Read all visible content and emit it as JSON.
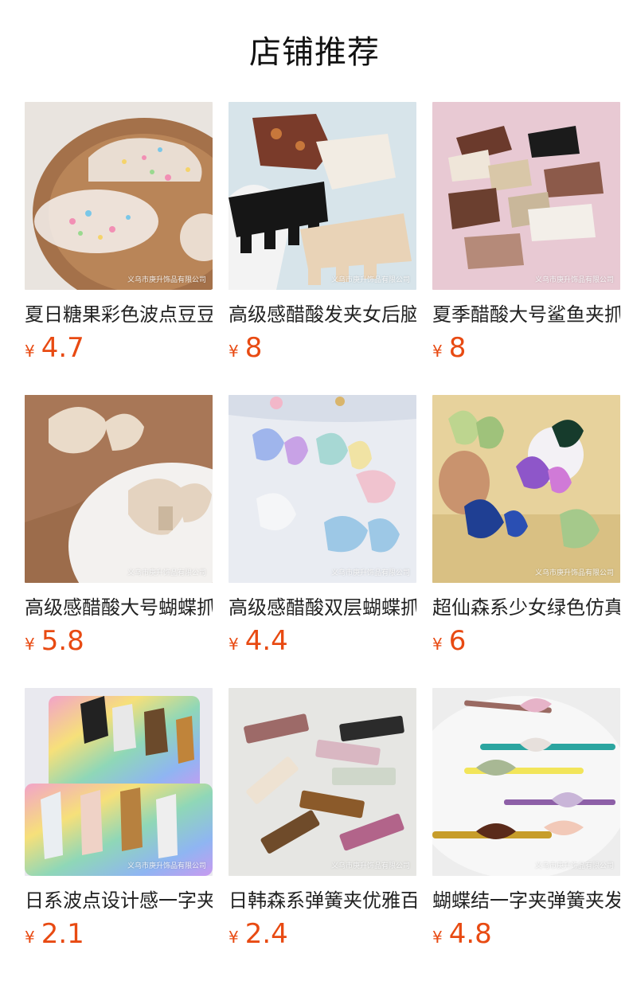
{
  "header": {
    "title": "店铺推荐"
  },
  "watermark": "义乌市庚升饰品有限公司",
  "currency": "¥",
  "colors": {
    "price": "#e84a12"
  },
  "products": [
    {
      "title": "夏日糖果彩色波点豆豆抓夹",
      "price": "4.7"
    },
    {
      "title": "高级感醋酸发夹女后脑勺",
      "price": "8"
    },
    {
      "title": "夏季醋酸大号鲨鱼夹抓夹",
      "price": "8"
    },
    {
      "title": "高级感醋酸大号蝴蝶抓夹",
      "price": "5.8"
    },
    {
      "title": "高级感醋酸双层蝴蝶抓夹",
      "price": "4.4"
    },
    {
      "title": "超仙森系少女绿色仿真蝴蝶",
      "price": "6"
    },
    {
      "title": "日系波点设计感一字夹",
      "price": "2.1"
    },
    {
      "title": "日韩森系弹簧夹优雅百搭",
      "price": "2.4"
    },
    {
      "title": "蝴蝶结一字夹弹簧夹发夹",
      "price": "4.8"
    }
  ]
}
